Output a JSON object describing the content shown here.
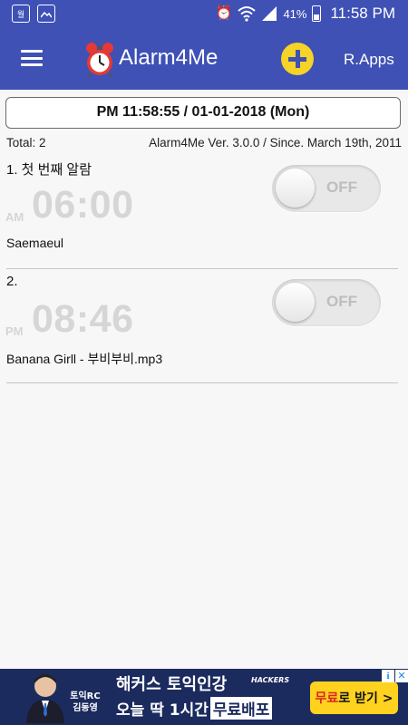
{
  "status_bar": {
    "carrier_badge": "월",
    "battery_percent": "41%",
    "time": "11:58 PM"
  },
  "app_bar": {
    "title": "Alarm4Me",
    "right_action": "R.Apps"
  },
  "current_datetime": "PM 11:58:55 / 01-01-2018 (Mon)",
  "summary": {
    "total": "Total: 2",
    "version": "Alarm4Me Ver. 3.0.0 / Since. March 19th, 2011"
  },
  "alarms": [
    {
      "name": "1.  첫 번째 알람",
      "ampm": "AM",
      "time": "06:00",
      "sound": "Saemaeul",
      "toggle": "OFF"
    },
    {
      "name": "2.",
      "ampm": "PM",
      "time": "08:46",
      "sound": "Banana Girll - 부비부비.mp3",
      "toggle": "OFF"
    }
  ],
  "ad": {
    "person_name_line1": "토익RC",
    "person_name_line2": "김동영",
    "headline": "해커스 토익인강",
    "brand": "HACKERS",
    "sub_text": "오늘 딱 1시간",
    "sub_highlight": "무료배포",
    "cta_red": "무료",
    "cta_rest": "로 받기 >",
    "info_glyph": "i",
    "close_glyph": "✕"
  },
  "colors": {
    "primary": "#3f51b5",
    "accent_add": "#f5d327",
    "ad_background": "#1c2b5e",
    "ad_cta": "#ffd21f"
  }
}
